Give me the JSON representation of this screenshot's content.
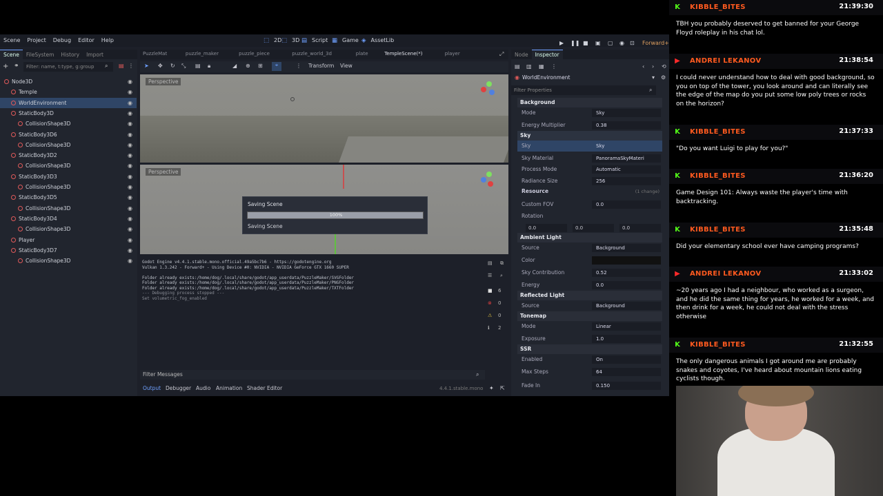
{
  "menu": [
    "Scene",
    "Project",
    "Debug",
    "Editor",
    "Help"
  ],
  "workspaces": [
    {
      "label": "2D",
      "icon": "2d-icon"
    },
    {
      "label": "3D",
      "icon": "3d-icon"
    },
    {
      "label": "Script",
      "icon": "script-icon"
    },
    {
      "label": "Game",
      "icon": "game-icon"
    },
    {
      "label": "AssetLib",
      "icon": "assetlib-icon"
    }
  ],
  "renderer": "Forward+",
  "left_dock": {
    "tabs": [
      "Scene",
      "FileSystem",
      "History",
      "Import"
    ],
    "filter_placeholder": "Filter: name, t:type, g:group",
    "tree": [
      {
        "label": "Node3D",
        "indent": 0,
        "sel": false
      },
      {
        "label": "Temple",
        "indent": 1,
        "sel": false
      },
      {
        "label": "WorldEnvironment",
        "indent": 1,
        "sel": true
      },
      {
        "label": "StaticBody3D",
        "indent": 1,
        "sel": false
      },
      {
        "label": "CollisionShape3D",
        "indent": 2,
        "sel": false
      },
      {
        "label": "StaticBody3D6",
        "indent": 1,
        "sel": false
      },
      {
        "label": "CollisionShape3D",
        "indent": 2,
        "sel": false
      },
      {
        "label": "StaticBody3D2",
        "indent": 1,
        "sel": false
      },
      {
        "label": "CollisionShape3D",
        "indent": 2,
        "sel": false
      },
      {
        "label": "StaticBody3D3",
        "indent": 1,
        "sel": false
      },
      {
        "label": "CollisionShape3D",
        "indent": 2,
        "sel": false
      },
      {
        "label": "StaticBody3D5",
        "indent": 1,
        "sel": false
      },
      {
        "label": "CollisionShape3D",
        "indent": 2,
        "sel": false
      },
      {
        "label": "StaticBody3D4",
        "indent": 1,
        "sel": false
      },
      {
        "label": "CollisionShape3D",
        "indent": 2,
        "sel": false
      },
      {
        "label": "Player",
        "indent": 1,
        "sel": false
      },
      {
        "label": "StaticBody3D7",
        "indent": 1,
        "sel": false
      },
      {
        "label": "CollisionShape3D",
        "indent": 2,
        "sel": false
      }
    ]
  },
  "scene_tabs": [
    "PuzzleMat",
    "puzzle_maker",
    "puzzle_piece",
    "puzzle_world_3d",
    "plate",
    "TempleScene(*)",
    "player"
  ],
  "viewport_toolbar": {
    "transform": "Transform",
    "view": "View"
  },
  "viewports": [
    "Perspective",
    "Perspective"
  ],
  "saving_dialog": {
    "title": "Saving Scene",
    "progress_percent": 100,
    "progress_label": "100%",
    "status": "Saving Scene"
  },
  "output": {
    "lines": [
      "Godot Engine v4.4.1.stable.mono.official.49a5bc7b6 - https://godotengine.org",
      "Vulkan 1.3.242 - Forward+ - Using Device #0: NVIDIA - NVIDIA GeForce GTX 1660 SUPER",
      "",
      "Folder already exists:/home/dog/.local/share/godot/app_userdata/PuzzleMaker/SVGFolder",
      "Folder already exists:/home/dog/.local/share/godot/app_userdata/PuzzleMaker/PNGFolder",
      "Folder already exists:/home/dog/.local/share/godot/app_userdata/PuzzleMaker/TXTFolder",
      "--- Debugging process stopped ---",
      "Set volumetric_fog_enabled"
    ],
    "filter_placeholder": "Filter Messages",
    "counts": [
      "6",
      "0",
      "0",
      "2"
    ],
    "bottom_tabs": [
      "Output",
      "Debugger",
      "Audio",
      "Animation",
      "Shader Editor"
    ],
    "version": "4.4.1.stable.mono"
  },
  "inspector": {
    "tabs": [
      "Node",
      "Inspector"
    ],
    "object": "WorldEnvironment",
    "filter_placeholder": "Filter Properties",
    "sections": {
      "background": "Background",
      "sky": "Sky",
      "resource": "Resource",
      "resource_note": "(1 change)",
      "ambient": "Ambient Light",
      "reflected": "Reflected Light",
      "tonemap": "Tonemap",
      "ssr": "SSR"
    },
    "props": {
      "bg_mode": {
        "label": "Mode",
        "value": "Sky"
      },
      "energy": {
        "label": "Energy Multiplier",
        "value": "0.38"
      },
      "sky": {
        "label": "Sky",
        "value": "Sky"
      },
      "sky_material": {
        "label": "Sky Material",
        "value": "PanoramaSkyMateri"
      },
      "process_mode": {
        "label": "Process Mode",
        "value": "Automatic"
      },
      "radiance": {
        "label": "Radiance Size",
        "value": "256"
      },
      "custom_fov": {
        "label": "Custom FOV",
        "value": "0.0"
      },
      "rotation": {
        "label": "Rotation",
        "x": "0.0",
        "y": "0.0",
        "z": "0.0"
      },
      "amb_source": {
        "label": "Source",
        "value": "Background"
      },
      "amb_color": {
        "label": "Color"
      },
      "sky_contrib": {
        "label": "Sky Contribution",
        "value": "0.52"
      },
      "amb_energy": {
        "label": "Energy",
        "value": "0.0"
      },
      "ref_source": {
        "label": "Source",
        "value": "Background"
      },
      "tone_mode": {
        "label": "Mode",
        "value": "Linear"
      },
      "exposure": {
        "label": "Exposure",
        "value": "1.0"
      },
      "ssr_enabled": {
        "label": "Enabled",
        "value": "On"
      },
      "max_steps": {
        "label": "Max Steps",
        "value": "64"
      },
      "fade_in": {
        "label": "Fade In",
        "value": "0.150"
      }
    }
  },
  "chat": [
    {
      "user": "KIBBLE_BITES",
      "time": "21:39:30",
      "color": "#ff5a1f",
      "badge": "K",
      "badge_color": "#53fc18",
      "text": "TBH you probably deserved to get banned for your George Floyd roleplay in his chat lol."
    },
    {
      "user": "ANDREI LEKANOV",
      "time": "21:38:54",
      "color": "#ff5a1f",
      "badge": "▶",
      "badge_color": "#ff2a2a",
      "text": "I could never understand how to deal with good background, so you on top of the tower, you look around and can literally see the edge of the map do you put some low poly trees or rocks on the horizon?"
    },
    {
      "user": "KIBBLE_BITES",
      "time": "21:37:33",
      "color": "#ff5a1f",
      "badge": "K",
      "badge_color": "#53fc18",
      "text": "\"Do you want Luigi to play for you?\""
    },
    {
      "user": "KIBBLE_BITES",
      "time": "21:36:20",
      "color": "#ff5a1f",
      "badge": "K",
      "badge_color": "#53fc18",
      "text": "Game Design 101: Always waste the player's time with backtracking."
    },
    {
      "user": "KIBBLE_BITES",
      "time": "21:35:48",
      "color": "#ff5a1f",
      "badge": "K",
      "badge_color": "#53fc18",
      "text": "Did your elementary school ever have camping programs?"
    },
    {
      "user": "ANDREI LEKANOV",
      "time": "21:33:02",
      "color": "#ff5a1f",
      "badge": "▶",
      "badge_color": "#ff2a2a",
      "text": "~20 years ago I had a neighbour, who worked as a surgeon, and he did the same thing for years, he worked for a week, and then drink for a week, he could not deal with the stress otherwise"
    },
    {
      "user": "KIBBLE_BITES",
      "time": "21:32:55",
      "color": "#ff5a1f",
      "badge": "K",
      "badge_color": "#53fc18",
      "text": "The only dangerous animals I got around me are probably snakes and coyotes, I've heard about mountain lions eating cyclists though."
    }
  ]
}
